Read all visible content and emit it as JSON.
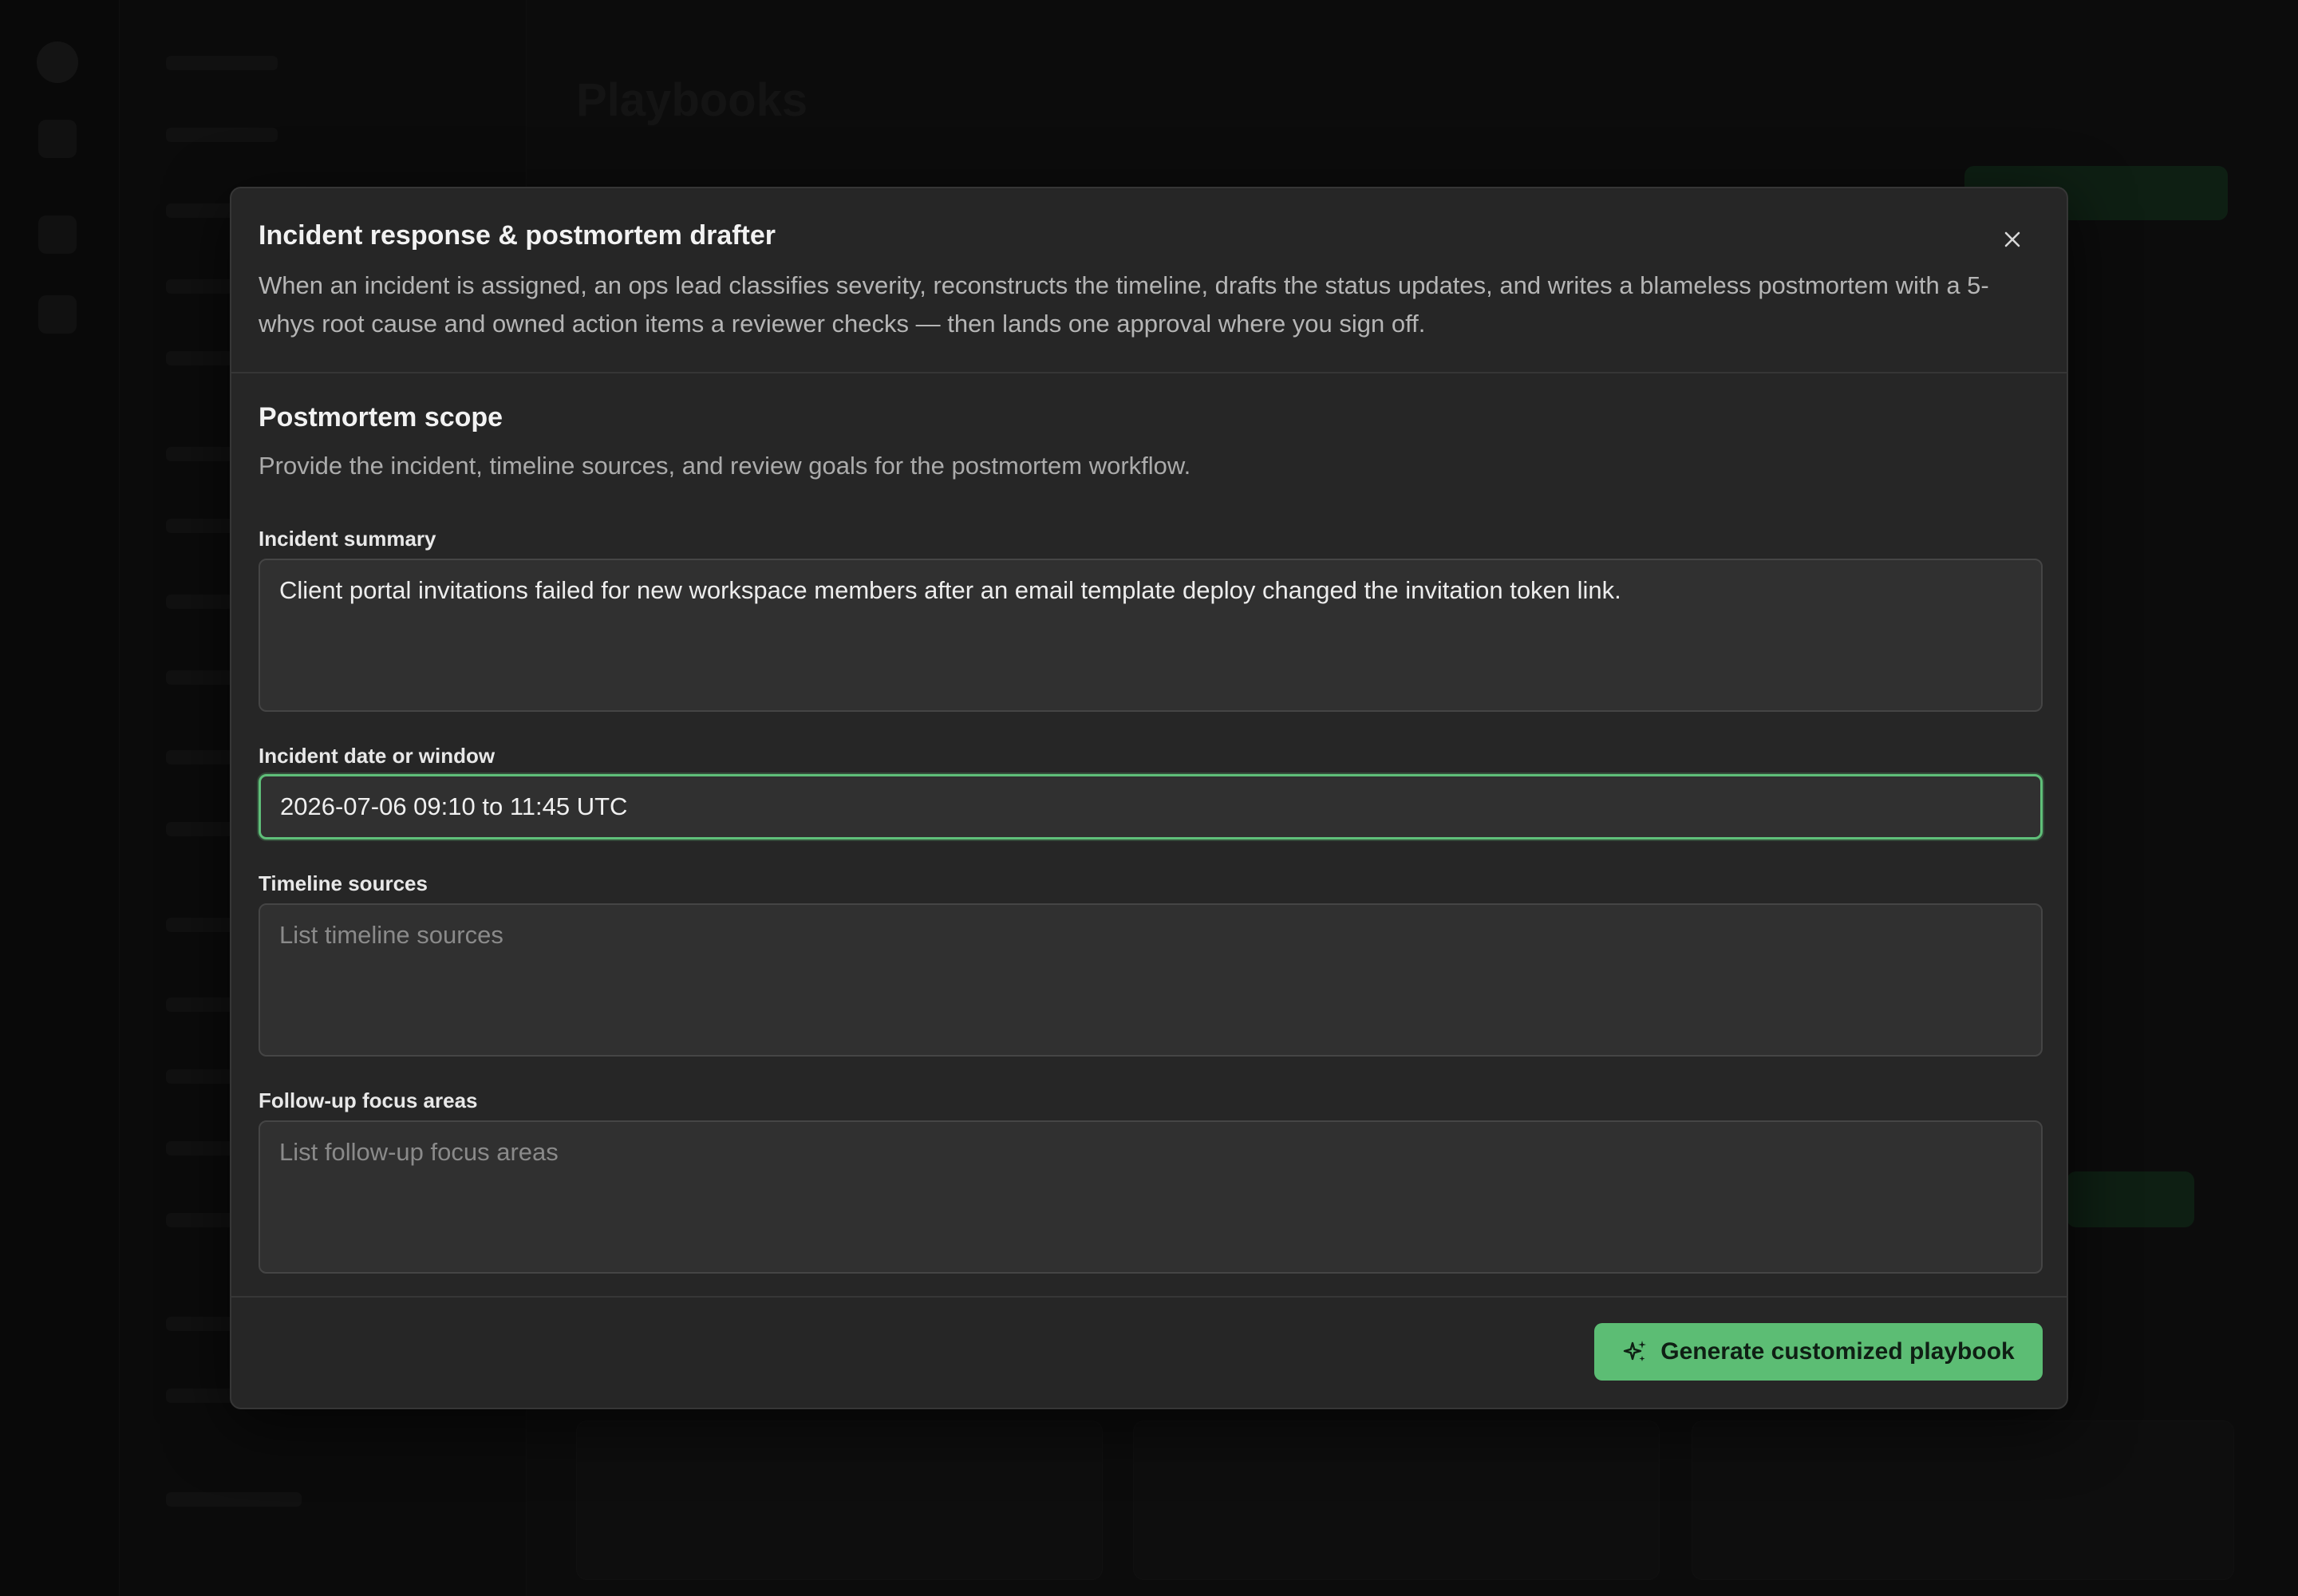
{
  "background": {
    "page_title": "Playbooks"
  },
  "modal": {
    "title": "Incident response & postmortem drafter",
    "description": "When an incident is assigned, an ops lead classifies severity, reconstructs the timeline, drafts the status updates, and writes a blameless postmortem with a 5-whys root cause and owned action items a reviewer checks — then lands one approval where you sign off.",
    "close_icon": "close-icon",
    "section": {
      "title": "Postmortem scope",
      "description": "Provide the incident, timeline sources, and review goals for the postmortem workflow."
    },
    "fields": {
      "incident_summary": {
        "label": "Incident summary",
        "value": "Client portal invitations failed for new workspace members after an email template deploy changed the invitation token link.",
        "placeholder": ""
      },
      "incident_date": {
        "label": "Incident date or window",
        "value": "2026-07-06 09:10 to 11:45 UTC"
      },
      "timeline_sources": {
        "label": "Timeline sources",
        "value": "",
        "placeholder": "List timeline sources"
      },
      "followup_focus": {
        "label": "Follow-up focus areas",
        "value": "",
        "placeholder": "List follow-up focus areas"
      }
    },
    "footer": {
      "generate_label": "Generate customized playbook",
      "generate_icon": "sparkles-icon"
    }
  },
  "colors": {
    "accent": "#5cbd74",
    "modal_bg": "#262626",
    "input_bg": "#303030"
  }
}
